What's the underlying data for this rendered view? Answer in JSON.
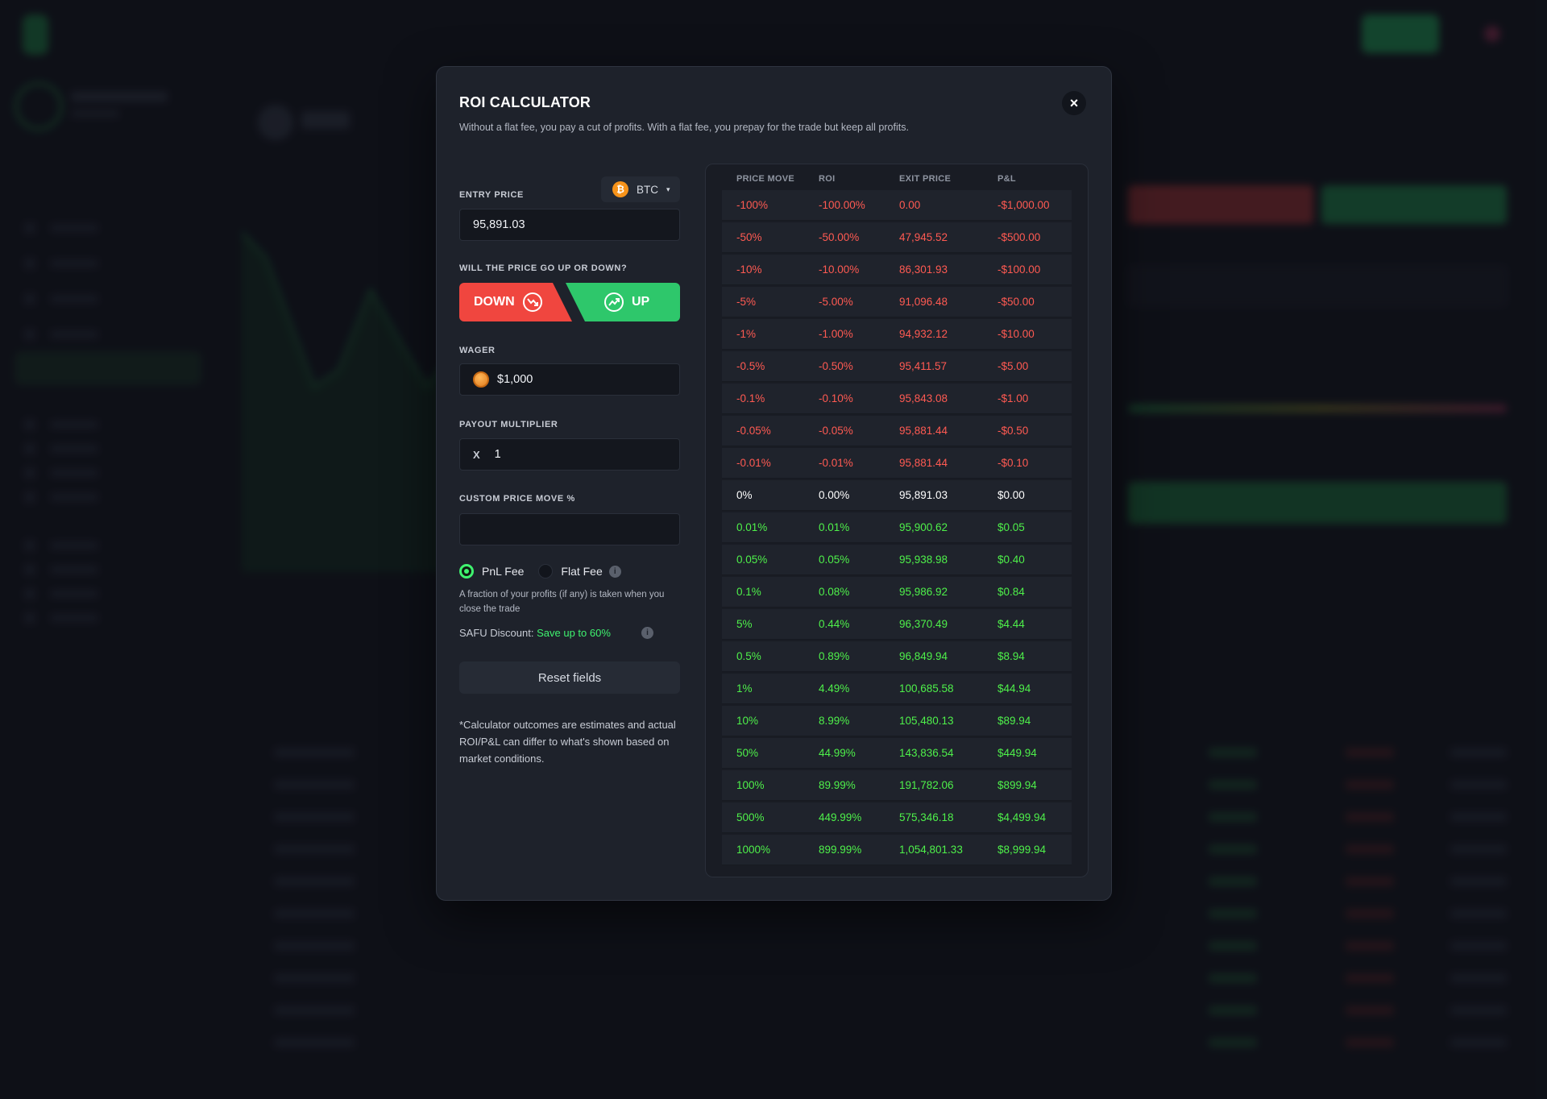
{
  "modal": {
    "title": "ROI CALCULATOR",
    "subtitle": "Without a flat fee, you pay a cut of profits. With a flat fee, you prepay for the trade but keep all profits.",
    "close_label": "×"
  },
  "form": {
    "entry_price_label": "ENTRY PRICE",
    "entry_price_value": "95,891.03",
    "coin": {
      "symbol": "BTC",
      "icon": "bitcoin-icon",
      "icon_glyph": "₿",
      "caret": "▾"
    },
    "direction_label": "WILL THE PRICE GO UP OR DOWN?",
    "down_label": "DOWN",
    "up_label": "UP",
    "wager_label": "WAGER",
    "wager_value": "$1,000",
    "multiplier_label": "PAYOUT MULTIPLIER",
    "multiplier_prefix": "X",
    "multiplier_value": "1",
    "custom_move_label": "CUSTOM PRICE MOVE %",
    "custom_move_value": "",
    "fee_options": [
      {
        "label": "PnL Fee",
        "selected": true
      },
      {
        "label": "Flat Fee",
        "selected": false
      }
    ],
    "info_glyph": "i",
    "fee_description": "A fraction of your profits (if any) is taken when you close the trade",
    "safu_label": "SAFU Discount:",
    "safu_value": "Save up to 60%",
    "reset_label": "Reset fields",
    "disclaimer": "*Calculator outcomes are estimates and actual ROI/P&L can differ to what's shown based on market conditions."
  },
  "table": {
    "headers": [
      "PRICE MOVE",
      "ROI",
      "EXIT PRICE",
      "P&L"
    ],
    "rows": [
      {
        "move": "-100%",
        "roi": "-100.00%",
        "exit": "0.00",
        "pnl": "-$1,000.00",
        "tone": "neg"
      },
      {
        "move": "-50%",
        "roi": "-50.00%",
        "exit": "47,945.52",
        "pnl": "-$500.00",
        "tone": "neg"
      },
      {
        "move": "-10%",
        "roi": "-10.00%",
        "exit": "86,301.93",
        "pnl": "-$100.00",
        "tone": "neg"
      },
      {
        "move": "-5%",
        "roi": "-5.00%",
        "exit": "91,096.48",
        "pnl": "-$50.00",
        "tone": "neg"
      },
      {
        "move": "-1%",
        "roi": "-1.00%",
        "exit": "94,932.12",
        "pnl": "-$10.00",
        "tone": "neg"
      },
      {
        "move": "-0.5%",
        "roi": "-0.50%",
        "exit": "95,411.57",
        "pnl": "-$5.00",
        "tone": "neg"
      },
      {
        "move": "-0.1%",
        "roi": "-0.10%",
        "exit": "95,843.08",
        "pnl": "-$1.00",
        "tone": "neg"
      },
      {
        "move": "-0.05%",
        "roi": "-0.05%",
        "exit": "95,881.44",
        "pnl": "-$0.50",
        "tone": "neg"
      },
      {
        "move": "-0.01%",
        "roi": "-0.01%",
        "exit": "95,881.44",
        "pnl": "-$0.10",
        "tone": "neg"
      },
      {
        "move": "0%",
        "roi": "0.00%",
        "exit": "95,891.03",
        "pnl": "$0.00",
        "tone": "zero"
      },
      {
        "move": "0.01%",
        "roi": "0.01%",
        "exit": "95,900.62",
        "pnl": "$0.05",
        "tone": "pos"
      },
      {
        "move": "0.05%",
        "roi": "0.05%",
        "exit": "95,938.98",
        "pnl": "$0.40",
        "tone": "pos"
      },
      {
        "move": "0.1%",
        "roi": "0.08%",
        "exit": "95,986.92",
        "pnl": "$0.84",
        "tone": "pos"
      },
      {
        "move": "5%",
        "roi": "0.44%",
        "exit": "96,370.49",
        "pnl": "$4.44",
        "tone": "pos"
      },
      {
        "move": "0.5%",
        "roi": "0.89%",
        "exit": "96,849.94",
        "pnl": "$8.94",
        "tone": "pos"
      },
      {
        "move": "1%",
        "roi": "4.49%",
        "exit": "100,685.58",
        "pnl": "$44.94",
        "tone": "pos"
      },
      {
        "move": "10%",
        "roi": "8.99%",
        "exit": "105,480.13",
        "pnl": "$89.94",
        "tone": "pos"
      },
      {
        "move": "50%",
        "roi": "44.99%",
        "exit": "143,836.54",
        "pnl": "$449.94",
        "tone": "pos"
      },
      {
        "move": "100%",
        "roi": "89.99%",
        "exit": "191,782.06",
        "pnl": "$899.94",
        "tone": "pos"
      },
      {
        "move": "500%",
        "roi": "449.99%",
        "exit": "575,346.18",
        "pnl": "$4,499.94",
        "tone": "pos"
      },
      {
        "move": "1000%",
        "roi": "899.99%",
        "exit": "1,054,801.33",
        "pnl": "$8,999.94",
        "tone": "pos"
      }
    ]
  },
  "colors": {
    "negative": "#ff5a52",
    "positive": "#4ef04a",
    "down_button": "#f0463f",
    "up_button": "#2ec76b",
    "modal_bg": "#1e222b"
  }
}
